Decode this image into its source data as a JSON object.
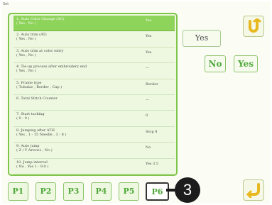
{
  "screen_tag": "Set",
  "settings": [
    {
      "name": "1. Auto Color Change (AC)\n( Yes , No )",
      "value": "Yes",
      "selected": true
    },
    {
      "name": "2. Auto trim (AT)\n( Yes , No )",
      "value": "Yes"
    },
    {
      "name": "3. Auto trim at color entry\n( Yes , No )",
      "value": "Yes"
    },
    {
      "name": "4. Tie-up process after embroidery end\n( Yes , No )",
      "value": "—"
    },
    {
      "name": "5. Frame type\n( Tubular , Border , Cap )",
      "value": "Border"
    },
    {
      "name": "6. Total Stitch Counter",
      "value": "—"
    },
    {
      "name": "7. Start tacking\n( 0 - 9 )",
      "value": "0"
    },
    {
      "name": "8. Jumping after ATH\n( Yes , 1 - 15 Needle , 3 - 8 )",
      "value": "Stop 8"
    },
    {
      "name": "9. Auto jump\n( Z / Y Arrows , No )",
      "value": "No"
    },
    {
      "name": "10. Jump interval\n( No , Yes 1 - 9.0 )",
      "value": "Yes 3.5"
    }
  ],
  "pages": [
    "P1",
    "P2",
    "P3",
    "P4",
    "P5",
    "P6"
  ],
  "active_page": "P6",
  "callout_number": "3",
  "current_value_button": "Yes",
  "options": {
    "no": "No",
    "yes": "Yes"
  },
  "colors": {
    "accent": "#8ed35a",
    "button_text": "#4fa83a"
  }
}
